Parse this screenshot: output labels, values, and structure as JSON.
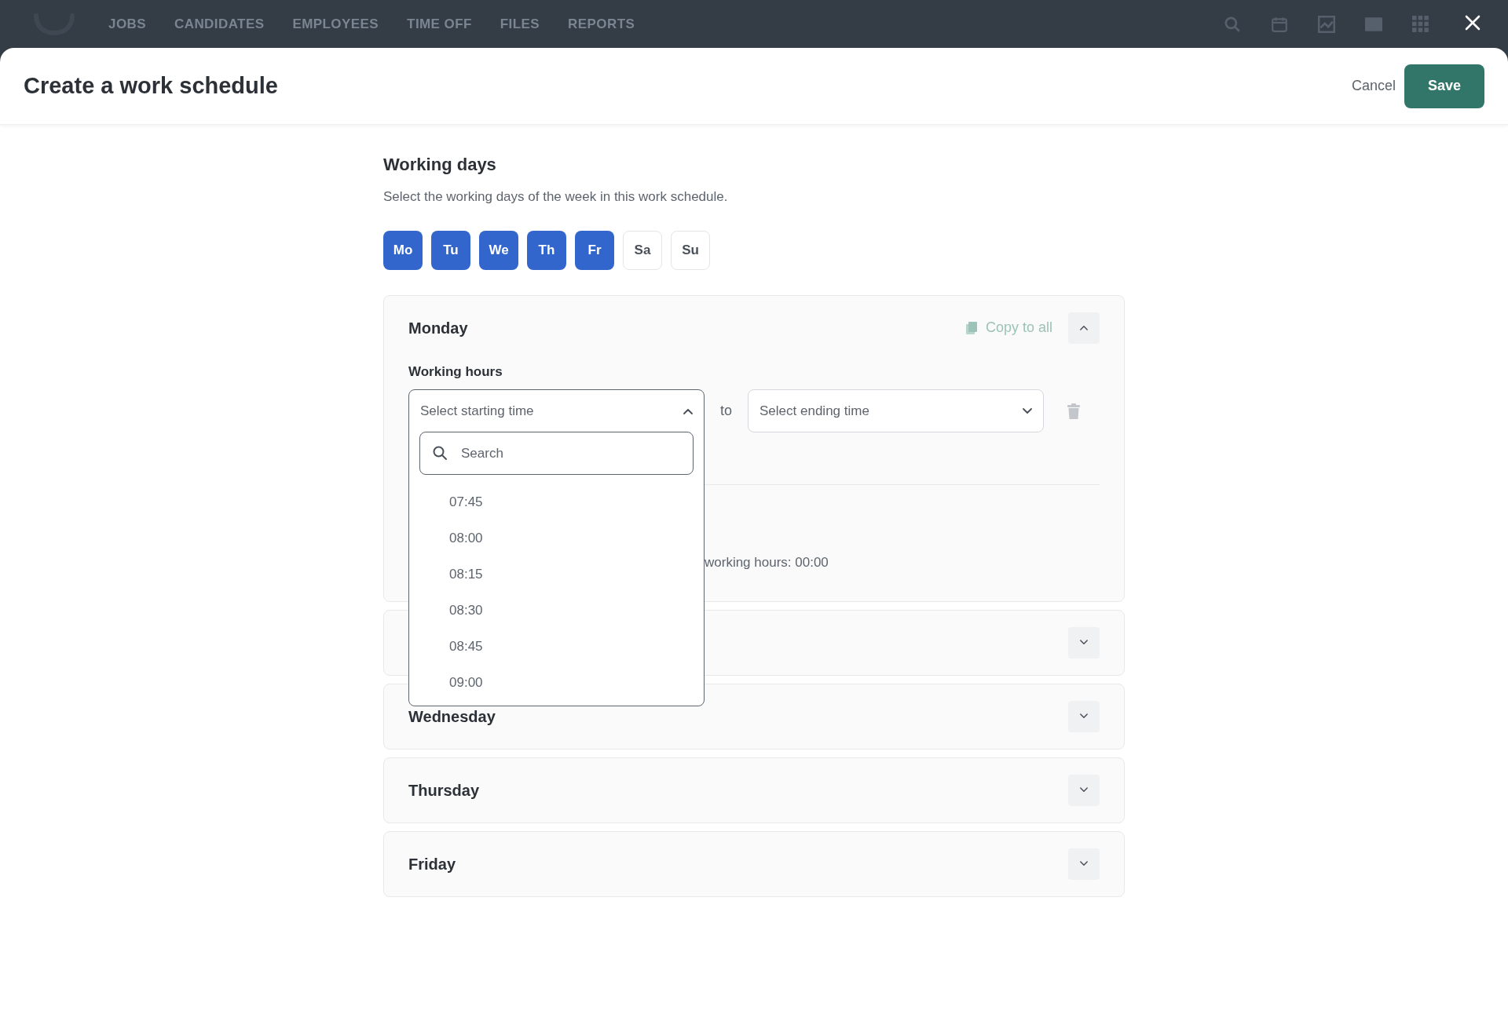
{
  "nav": {
    "items": [
      "JOBS",
      "CANDIDATES",
      "EMPLOYEES",
      "TIME OFF",
      "FILES",
      "REPORTS"
    ]
  },
  "modal": {
    "title": "Create a work schedule",
    "cancel": "Cancel",
    "save": "Save"
  },
  "working_days": {
    "heading": "Working days",
    "description": "Select the working days of the week in this work schedule.",
    "days": [
      {
        "label": "Mo",
        "selected": true
      },
      {
        "label": "Tu",
        "selected": true
      },
      {
        "label": "We",
        "selected": true
      },
      {
        "label": "Th",
        "selected": true
      },
      {
        "label": "Fr",
        "selected": true
      },
      {
        "label": "Sa",
        "selected": false
      },
      {
        "label": "Su",
        "selected": false
      }
    ]
  },
  "day_panels": [
    {
      "name": "Monday",
      "expanded": true,
      "copy_to_all": "Copy to all",
      "hours_label": "Working hours",
      "start_placeholder": "Select starting time",
      "to": "to",
      "end_placeholder": "Select ending time",
      "total": "working hours: 00:00"
    },
    {
      "expanded": false
    },
    {
      "name": "Wednesday",
      "expanded": false
    },
    {
      "name": "Thursday",
      "expanded": false
    },
    {
      "name": "Friday",
      "expanded": false
    }
  ],
  "start_dropdown": {
    "search_placeholder": "Search",
    "options": [
      "07:45",
      "08:00",
      "08:15",
      "08:30",
      "08:45",
      "09:00"
    ]
  }
}
